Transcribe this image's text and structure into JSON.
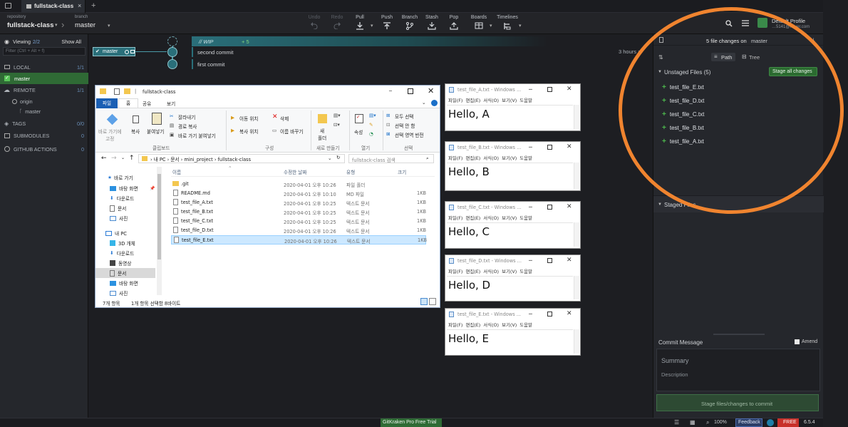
{
  "tabbar": {
    "repo_tab": "fullstack-class",
    "close": "×",
    "add": "+"
  },
  "toolbar": {
    "repo_label": "repository",
    "repo_value": "fullstack-class",
    "branch_label": "branch",
    "branch_value": "master",
    "undo": "Undo",
    "redo": "Redo",
    "pull": "Pull",
    "push": "Push",
    "branch": "Branch",
    "stash": "Stash",
    "pop": "Pop",
    "boards": "Boards",
    "timelines": "Timelines",
    "profile_name": "Default Profile",
    "profile_email": "…5141@naver.com"
  },
  "sidebar": {
    "viewing": "Viewing",
    "viewing_count": "2/2",
    "show_all": "Show All",
    "filter_placeholder": "Filter (Ctrl + Alt + f)",
    "local": "LOCAL",
    "local_count": "1/1",
    "local_branch": "master",
    "remote": "REMOTE",
    "remote_count": "1/1",
    "remote_name": "origin",
    "remote_branch": "master",
    "tags": "TAGS",
    "tags_count": "0/0",
    "submodules": "SUBMODULES",
    "submodules_count": "0",
    "github_actions": "GITHUB ACTIONS",
    "github_actions_count": "0"
  },
  "graph": {
    "wip": "// WIP",
    "wip_count": "+ 5",
    "branch_label": "master",
    "commits": [
      "second commit",
      "first commit"
    ],
    "time": "3 hours a"
  },
  "right": {
    "changes": "5 file changes on",
    "changes_branch": "master",
    "path": "Path",
    "tree": "Tree",
    "unstaged": "Unstaged Files (5)",
    "stage_all": "Stage all changes",
    "files": [
      "test_file_E.txt",
      "test_file_D.txt",
      "test_file_C.txt",
      "test_file_B.txt",
      "test_file_A.txt"
    ],
    "staged": "Staged Files",
    "commit_message": "Commit Message",
    "amend": "Amend",
    "summary": "Summary",
    "description": "Description",
    "stage_button": "Stage files/changes to commit"
  },
  "status": {
    "trial": "GitKraken Pro Free Trial",
    "zoom": "100%",
    "feedback": "Feedback",
    "free": "FREE",
    "version": "6.5.4"
  },
  "explorer": {
    "title": "fullstack-class",
    "ribbon_tabs": [
      "파일",
      "홈",
      "공유",
      "보기"
    ],
    "pin": "바로 가기에\n고정",
    "copy": "복사",
    "paste": "붙여넣기",
    "cut": "잘라내기",
    "copy_path": "경로 복사",
    "paste_shortcut": "바로 가기 붙여넣기",
    "clipboard": "클립보드",
    "move_to": "이동 위치",
    "delete": "삭제",
    "copy_to": "복사 위치",
    "rename": "이름 바꾸기",
    "organize": "구성",
    "new_folder": "새\n폴더",
    "new": "새로 만들기",
    "properties": "속성",
    "open": "열기",
    "select_all": "모두 선택",
    "select_none": "선택 안 함",
    "invert": "선택 영역 반전",
    "select": "선택",
    "path": [
      "내 PC",
      "문서",
      "mini_project",
      "fullstack-class"
    ],
    "search_placeholder": "fullstack-class 검색",
    "col_name": "이름",
    "col_date": "수정한 날짜",
    "col_type": "유형",
    "col_size": "크기",
    "nav": [
      "바로 가기",
      "바탕 화면",
      "다운로드",
      "문서",
      "사진",
      "내 PC",
      "3D 개체",
      "다운로드",
      "동영상",
      "문서",
      "바탕 화면",
      "사진"
    ],
    "files": [
      {
        "name": ".git",
        "date": "2020-04-01 오후 10:26",
        "type": "파일 폴더",
        "size": ""
      },
      {
        "name": "README.md",
        "date": "2020-04-01 오후 10:10",
        "type": "MD 파일",
        "size": "1KB"
      },
      {
        "name": "test_file_A.txt",
        "date": "2020-04-01 오후 10:25",
        "type": "텍스트 문서",
        "size": "1KB"
      },
      {
        "name": "test_file_B.txt",
        "date": "2020-04-01 오후 10:25",
        "type": "텍스트 문서",
        "size": "1KB"
      },
      {
        "name": "test_file_C.txt",
        "date": "2020-04-01 오후 10:25",
        "type": "텍스트 문서",
        "size": "1KB"
      },
      {
        "name": "test_file_D.txt",
        "date": "2020-04-01 오후 10:26",
        "type": "텍스트 문서",
        "size": "1KB"
      },
      {
        "name": "test_file_E.txt",
        "date": "2020-04-01 오후 10:26",
        "type": "텍스트 문서",
        "size": "1KB"
      }
    ],
    "status_items": "7개 항목",
    "status_selected": "1개 항목 선택함 8바이트"
  },
  "notepads": [
    {
      "title": "test_file_A.txt - Windows ...",
      "body": "Hello, A"
    },
    {
      "title": "test_file_B.txt - Windows ...",
      "body": "Hello, B"
    },
    {
      "title": "test_file_C.txt - Windows ...",
      "body": "Hello, C"
    },
    {
      "title": "test_file_D.txt - Windows ...",
      "body": "Hello, D"
    },
    {
      "title": "test_file_E.txt - Windows ...",
      "body": "Hello, E"
    }
  ],
  "notepad_menu": "파일(F) 편집(E) 서식(O) 보기(V) 도움말",
  "colors": {
    "accent_green": "#4db84d",
    "branch_teal": "#2a6f7a",
    "annotation": "#f0842f"
  }
}
